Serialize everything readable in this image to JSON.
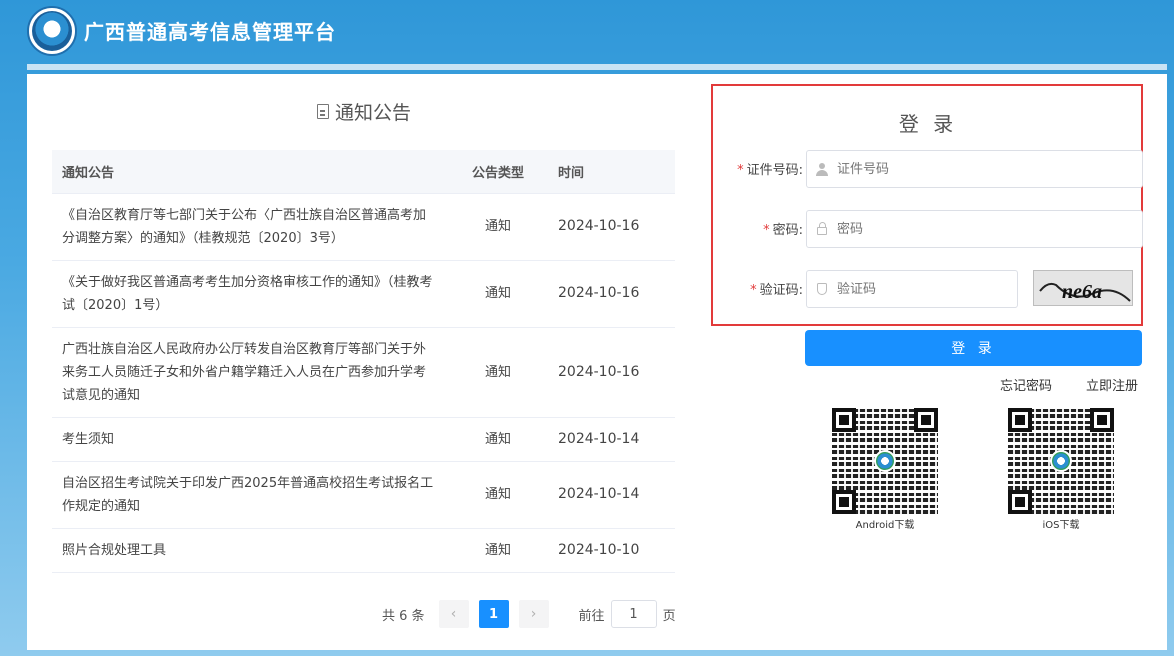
{
  "header": {
    "title": "广西普通高考信息管理平台",
    "logo_icon": "exam-logo-icon"
  },
  "notices": {
    "heading": "通知公告",
    "columns": [
      "通知公告",
      "公告类型",
      "时间"
    ],
    "rows": [
      {
        "title": "《自治区教育厅等七部门关于公布〈广西壮族自治区普通高考加分调整方案〉的通知》（桂教规范〔2020〕3号）",
        "type": "通知",
        "date": "2024-10-16"
      },
      {
        "title": "《关于做好我区普通高考考生加分资格审核工作的通知》（桂教考试〔2020〕1号）",
        "type": "通知",
        "date": "2024-10-16"
      },
      {
        "title": "广西壮族自治区人民政府办公厅转发自治区教育厅等部门关于外来务工人员随迁子女和外省户籍学籍迁入人员在广西参加升学考试意见的通知",
        "type": "通知",
        "date": "2024-10-16"
      },
      {
        "title": "考生须知",
        "type": "通知",
        "date": "2024-10-14"
      },
      {
        "title": "自治区招生考试院关于印发广西2025年普通高校招生考试报名工作规定的通知",
        "type": "通知",
        "date": "2024-10-14"
      },
      {
        "title": "照片合规处理工具",
        "type": "通知",
        "date": "2024-10-10"
      }
    ],
    "pagination": {
      "total": "共 6 条",
      "prev": "‹",
      "current": "1",
      "next": "›",
      "goto_prefix": "前往",
      "goto_value": "1",
      "goto_suffix": "页"
    }
  },
  "login": {
    "title": "登 录",
    "id_label": "证件号码:",
    "id_placeholder": "证件号码",
    "password_label": "密码:",
    "password_placeholder": "密码",
    "captcha_label": "验证码:",
    "captcha_placeholder": "验证码",
    "captcha_text": "ne6a",
    "submit": "登 录",
    "forgot": "忘记密码",
    "register": "立即注册"
  },
  "downloads": {
    "android": "Android下载",
    "ios": "iOS下载"
  },
  "colors": {
    "primary": "#1890ff",
    "highlight": "#e23a3a",
    "header_bg": "#2f97d8"
  }
}
